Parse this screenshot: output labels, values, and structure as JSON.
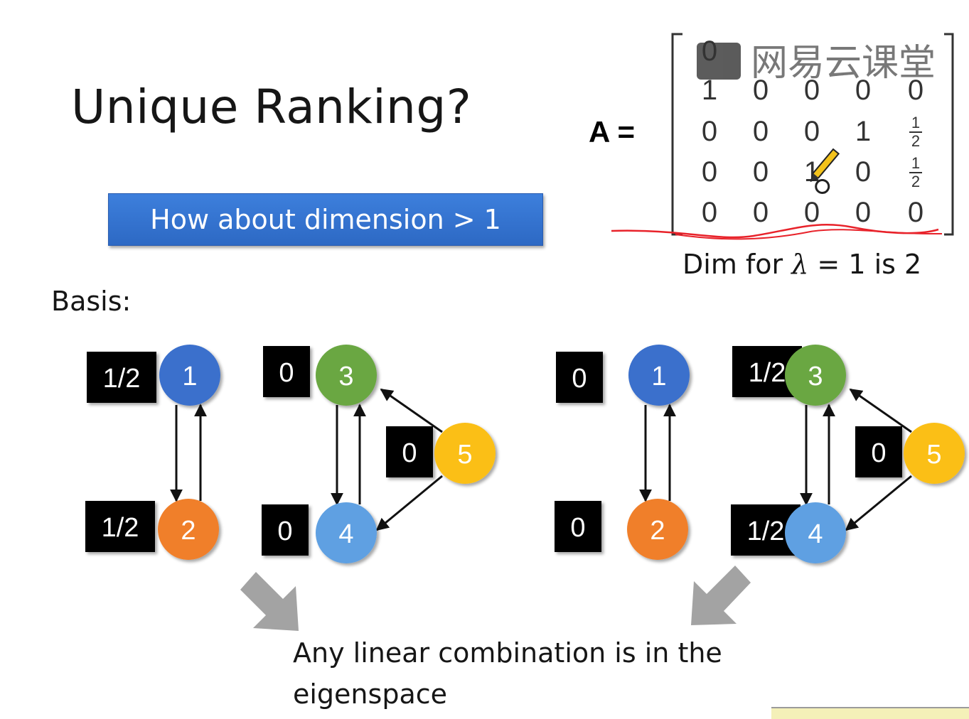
{
  "title": "Unique Ranking?",
  "button_label": "How about dimension > 1",
  "basis_label": "Basis:",
  "matrix": {
    "lhs": "A =",
    "rows": [
      [
        "0",
        "",
        "",
        "",
        ""
      ],
      [
        "1",
        "0",
        "0",
        "0",
        "0"
      ],
      [
        "0",
        "0",
        "0",
        "1",
        "1/2"
      ],
      [
        "0",
        "0",
        "1",
        "0",
        "1/2"
      ],
      [
        "0",
        "0",
        "0",
        "0",
        "0"
      ]
    ]
  },
  "dim_note": {
    "prefix": "Dim for ",
    "symbol": "λ",
    "suffix": " = 1 is 2"
  },
  "graphs": [
    {
      "scores": {
        "1": "1/2",
        "2": "1/2",
        "3": "0",
        "4": "0",
        "5": "0"
      }
    },
    {
      "scores": {
        "1": "0",
        "2": "0",
        "3": "1/2",
        "4": "1/2",
        "5": "0"
      }
    }
  ],
  "node_labels": [
    "1",
    "2",
    "3",
    "4",
    "5"
  ],
  "node_colors": {
    "1": "#3b6fcc",
    "2": "#f07f2a",
    "3": "#6aa742",
    "4": "#5ea0e2",
    "5": "#fbbf18"
  },
  "caption_lines": [
    "Any linear combination is in the",
    "eigenspace"
  ],
  "watermark": "网易云课堂",
  "annotation_color": "#e8222a"
}
